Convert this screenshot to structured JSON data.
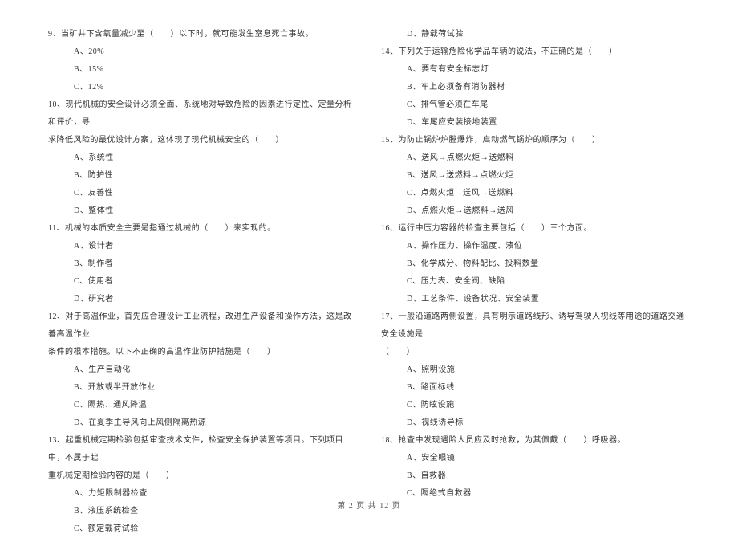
{
  "left": {
    "q9": {
      "text": "9、当矿井下含氧量减少至（　　）以下时，就可能发生窒息死亡事故。",
      "a": "A、20%",
      "b": "B、15%",
      "c": "C、12%"
    },
    "q10": {
      "text1": "10、现代机械的安全设计必须全面、系统地对导致危险的因素进行定性、定量分析和评价，寻",
      "text2": "求降低风险的最优设计方案，这体现了现代机械安全的（　　）",
      "a": "A、系统性",
      "b": "B、防护性",
      "c": "C、友善性",
      "d": "D、整体性"
    },
    "q11": {
      "text": "11、机械的本质安全主要是指通过机械的（　　）来实现的。",
      "a": "A、设计者",
      "b": "B、制作者",
      "c": "C、使用者",
      "d": "D、研究者"
    },
    "q12": {
      "text1": "12、对于高温作业，首先应合理设计工业流程，改进生产设备和操作方法，这是改善高温作业",
      "text2": "条件的根本措施。以下不正确的高温作业防护措施是（　　）",
      "a": "A、生产自动化",
      "b": "B、开放或半开放作业",
      "c": "C、隔热、通风降温",
      "d": "D、在夏季主导风向上风侧隔离热源"
    },
    "q13": {
      "text1": "13、起重机械定期检验包括审查技术文件，检查安全保护装置等项目。下列项目中，不属于起",
      "text2": "重机械定期检验内容的是（　　）",
      "a": "A、力矩限制器检查",
      "b": "B、液压系统检查",
      "c": "C、额定载荷试验"
    }
  },
  "right": {
    "q13d": "D、静载荷试验",
    "q14": {
      "text": "14、下列关于运输危险化学品车辆的说法，不正确的是（　　）",
      "a": "A、要有有安全标志灯",
      "b": "B、车上必须备有消防器材",
      "c": "C、排气管必须在车尾",
      "d": "D、车尾应安装接地装置"
    },
    "q15": {
      "text": "15、为防止锅炉炉膛爆炸，启动燃气锅炉的顺序为（　　）",
      "a": "A、送风→点燃火炬→送燃料",
      "b": "B、送风→送燃料→点燃火炬",
      "c": "C、点燃火炬→送风→送燃料",
      "d": "D、点燃火炬→送燃料→送风"
    },
    "q16": {
      "text": "16、运行中压力容器的检查主要包括（　　）三个方面。",
      "a": "A、操作压力、操作温度、液位",
      "b": "B、化学成分、物料配比、投料数量",
      "c": "C、压力表、安全阀、缺陷",
      "d": "D、工艺条件、设备状况、安全装置"
    },
    "q17": {
      "text1": "17、一般沿道路两侧设置，具有明示道路线形、诱导驾驶人视线等用途的道路交通安全设施是",
      "text2": "（　　）",
      "a": "A、照明设施",
      "b": "B、路面标线",
      "c": "C、防眩设施",
      "d": "D、视线诱导标"
    },
    "q18": {
      "text": "18、抢查中发现遇险人员应及时抢救，为其佩戴（　　）呼吸器。",
      "a": "A、安全眼镜",
      "b": "B、自救器",
      "c": "C、隔绝式自救器"
    }
  },
  "footer": "第 2 页 共 12 页"
}
